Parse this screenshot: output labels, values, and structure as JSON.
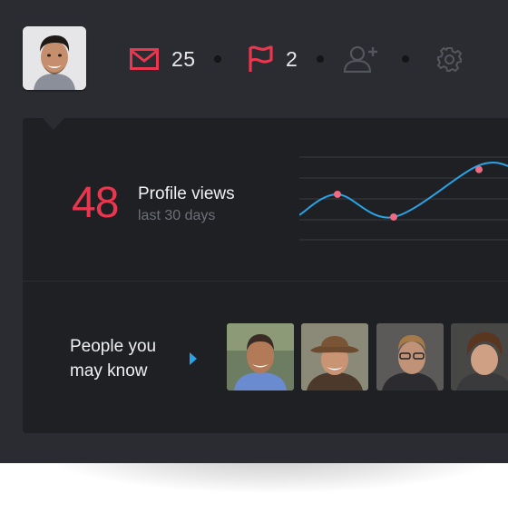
{
  "header": {
    "avatar_icon": "user-avatar",
    "messages": {
      "icon": "envelope-icon",
      "count": "25"
    },
    "flags": {
      "icon": "flag-icon",
      "count": "2"
    },
    "add_friend": {
      "icon": "add-user-icon"
    },
    "settings": {
      "icon": "gear-icon"
    }
  },
  "profile_views": {
    "count": "48",
    "title": "Profile views",
    "subtitle": "last 30 days"
  },
  "chart_data": {
    "type": "line",
    "title": "",
    "xlabel": "",
    "ylabel": "",
    "grid": true,
    "series": [
      {
        "values": [
          1.2,
          2.2,
          1.1,
          3.6,
          3.4
        ],
        "highlighted_points": [
          1,
          2,
          4
        ]
      }
    ]
  },
  "people": {
    "title_line1": "People you",
    "title_line2": "may know",
    "items": [
      {
        "avatar": "person-1"
      },
      {
        "avatar": "person-2"
      },
      {
        "avatar": "person-3"
      },
      {
        "avatar": "person-4"
      }
    ]
  },
  "colors": {
    "accent_red": "#e8374e",
    "accent_blue": "#2aa3e6",
    "background": "#2b2c31",
    "panel": "#1f2024"
  }
}
